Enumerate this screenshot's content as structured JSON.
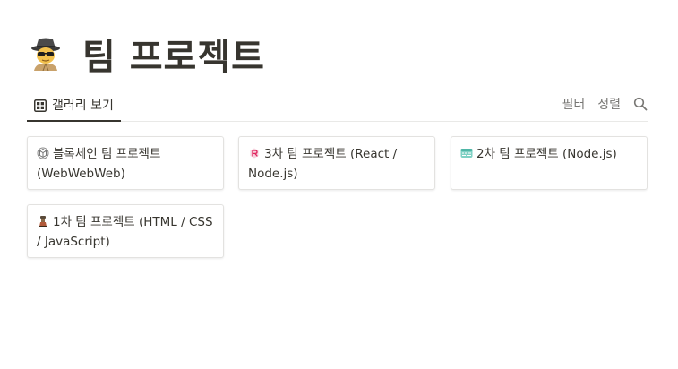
{
  "page": {
    "title": "팀 프로젝트",
    "title_icon": "spy-emoji-icon"
  },
  "tabs": {
    "gallery_label": "갤러리 보기",
    "gallery_icon": "gallery-grid-icon",
    "filter_label": "필터",
    "sort_label": "정렬",
    "search_icon": "search-icon"
  },
  "cards": [
    {
      "icon": "blockchain-icon",
      "title": "블록체인 팀 프로젝트 (WebWebWeb)"
    },
    {
      "icon": "react-icon",
      "title": "3차 팀 프로젝트 (React / Node.js)"
    },
    {
      "icon": "node-icon",
      "title": "2차 팀 프로젝트 (Node.js)"
    },
    {
      "icon": "html-css-js-icon",
      "title": "1차 팀 프로젝트 (HTML / CSS / JavaScript)"
    }
  ],
  "colors": {
    "text": "#37352f",
    "muted": "#787774",
    "border": "#e3e2e0",
    "divider": "#e9e9e7"
  }
}
